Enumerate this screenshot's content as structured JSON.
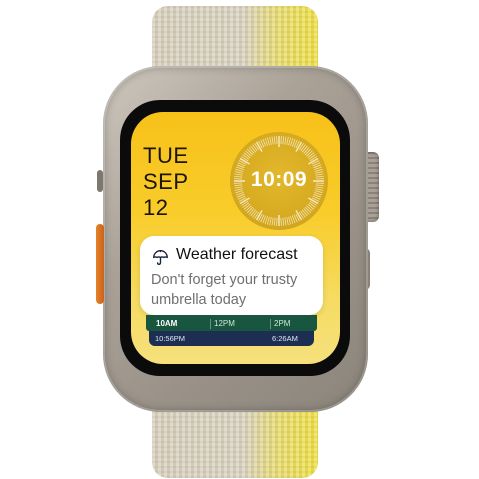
{
  "date": {
    "weekday": "TUE",
    "month": "SEP",
    "day": "12"
  },
  "clock": {
    "time": "10:09"
  },
  "notification": {
    "icon": "umbrella-icon",
    "title": "Weather forecast",
    "body": "Don't forget your trusty umbrella today"
  },
  "timeline": {
    "labels": [
      "10AM",
      "12PM",
      "2PM"
    ]
  },
  "tide": {
    "times": [
      "10:56PM",
      "6:26AM"
    ]
  },
  "colors": {
    "screen_yellow": "#f8c11a",
    "action_button": "#e9812a",
    "timeline_green": "#18563f",
    "tide_blue": "#1c2f52"
  }
}
